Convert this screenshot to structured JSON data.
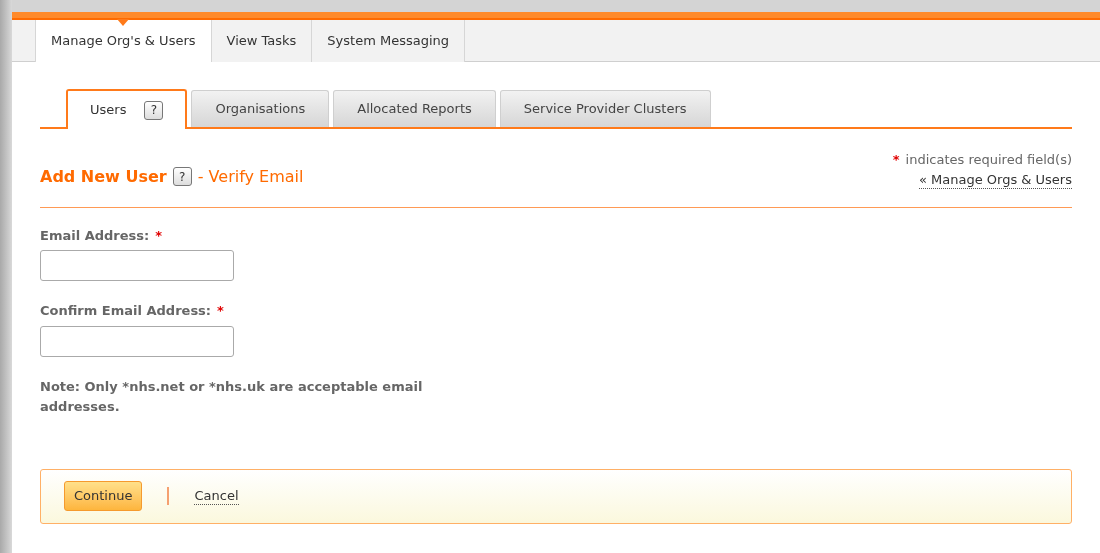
{
  "main_tabs": [
    {
      "label": "Manage Org's & Users",
      "selected": true
    },
    {
      "label": "View Tasks",
      "selected": false
    },
    {
      "label": "System Messaging",
      "selected": false
    }
  ],
  "sub_tabs": [
    {
      "label": "Users",
      "help": "?",
      "selected": true
    },
    {
      "label": "Organisations",
      "selected": false
    },
    {
      "label": "Allocated Reports",
      "selected": false
    },
    {
      "label": "Service Provider Clusters",
      "selected": false
    }
  ],
  "heading": {
    "title": "Add New User",
    "help": "?",
    "subtitle": "- Verify Email"
  },
  "required_legend": {
    "mark": "*",
    "text": "indicates required field(s)"
  },
  "back_link": "« Manage Orgs & Users",
  "fields": [
    {
      "label": "Email Address:",
      "required_mark": "*"
    },
    {
      "label": "Confirm Email Address:",
      "required_mark": "*"
    }
  ],
  "note": "Note: Only *nhs.net or *nhs.uk are acceptable email addresses.",
  "actions": {
    "primary": "Continue",
    "cancel": "Cancel"
  }
}
